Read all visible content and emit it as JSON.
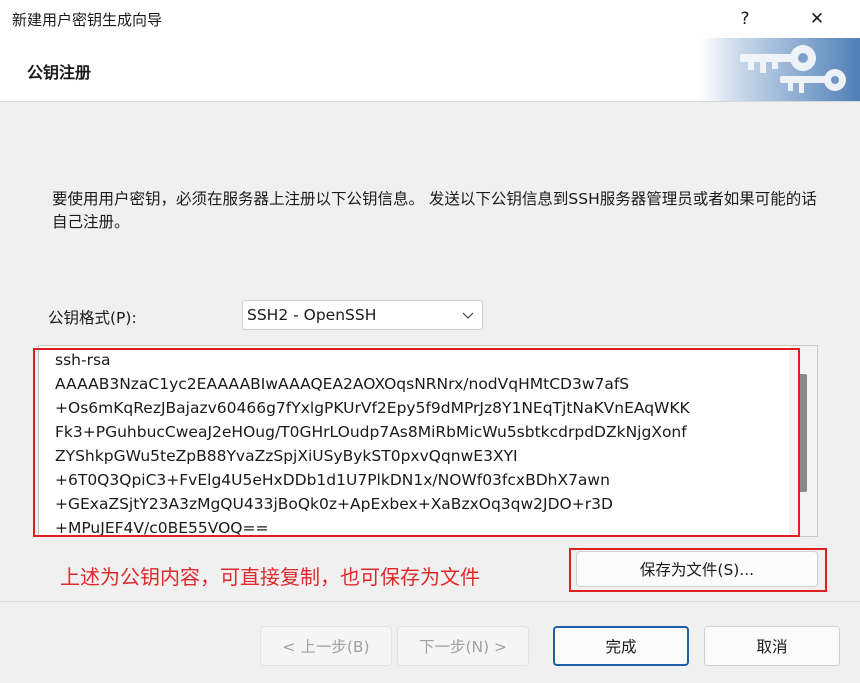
{
  "window": {
    "title": "新建用户密钥生成向导",
    "help_glyph": "?",
    "close_glyph": "✕"
  },
  "header": {
    "heading": "公钥注册"
  },
  "description": "要使用用户密钥，必须在服务器上注册以下公钥信息。 发送以下公钥信息到SSH服务器管理员或者如果可能的话自己注册。",
  "format": {
    "label": "公钥格式(P):",
    "selected": "SSH2 - OpenSSH"
  },
  "public_key_text": "ssh-rsa\nAAAAB3NzaC1yc2EAAAABIwAAAQEA2AOXOqsNRNrx/nodVqHMtCD3w7afS\n+Os6mKqRezJBajazv60466g7fYxlgPKUrVf2Epy5f9dMPrJz8Y1NEqTjtNaKVnEAqWKK\nFk3+PGuhbucCweaJ2eHOug/T0GHrLOudp7As8MiRbMicWu5sbtkcdrpdDZkNjgXonf\nZYShkpGWu5teZpB88YvaZzSpjXiUSyBykST0pxvQqnwE3XYI\n+6T0Q3QpiC3+FvElg4U5eHxDDb1d1U7PlkDN1x/NOWf03fcxBDhX7awn\n+GExaZSjtY23A3zMgQU433jBoQk0z+ApExbex+XaBzxOq3qw2JDO+r3D\n+MPuJEF4V/c0BE55VOQ==",
  "annotation": "上述为公钥内容，可直接复制，也可保存为文件",
  "save_button": "保存为文件(S)...",
  "footer": {
    "prev": "< 上一步(B)",
    "next": "下一步(N) >",
    "finish": "完成",
    "cancel": "取消"
  },
  "colors": {
    "annotation_red": "#e02a2a",
    "primary_border": "#1f5fa8"
  }
}
